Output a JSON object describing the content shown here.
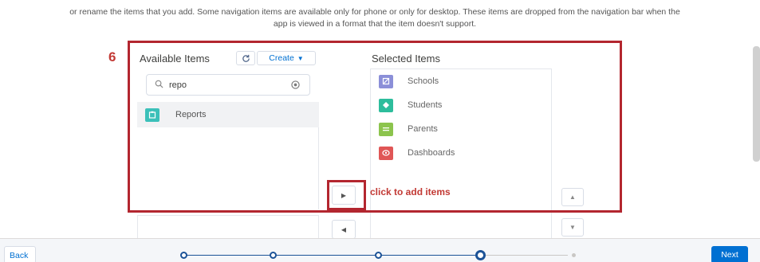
{
  "intro": {
    "line1": "or rename the items that you add. Some navigation items are available only for phone or only for desktop. These items are dropped from the navigation bar when the",
    "line2": "app is viewed in a format that the item doesn't support."
  },
  "step_number": "6",
  "available": {
    "title": "Available Items",
    "create_label": "Create",
    "search_value": "repo",
    "items": [
      {
        "label": "Reports",
        "icon": "reports-icon",
        "color": "#3bc0b9"
      }
    ]
  },
  "selected": {
    "title": "Selected Items",
    "items": [
      {
        "label": "Schools",
        "icon": "schools-icon",
        "color": "#8b8fd8"
      },
      {
        "label": "Students",
        "icon": "students-icon",
        "color": "#2dbd9c"
      },
      {
        "label": "Parents",
        "icon": "parents-icon",
        "color": "#8cc44d"
      },
      {
        "label": "Dashboards",
        "icon": "dashboards-icon",
        "color": "#e05656"
      }
    ]
  },
  "callout_text": "click to add items",
  "footer": {
    "back_label": "Back",
    "next_label": "Next"
  },
  "colors": {
    "highlight": "#b3262f",
    "brand": "#0070d2",
    "progress": "#1b5297"
  }
}
